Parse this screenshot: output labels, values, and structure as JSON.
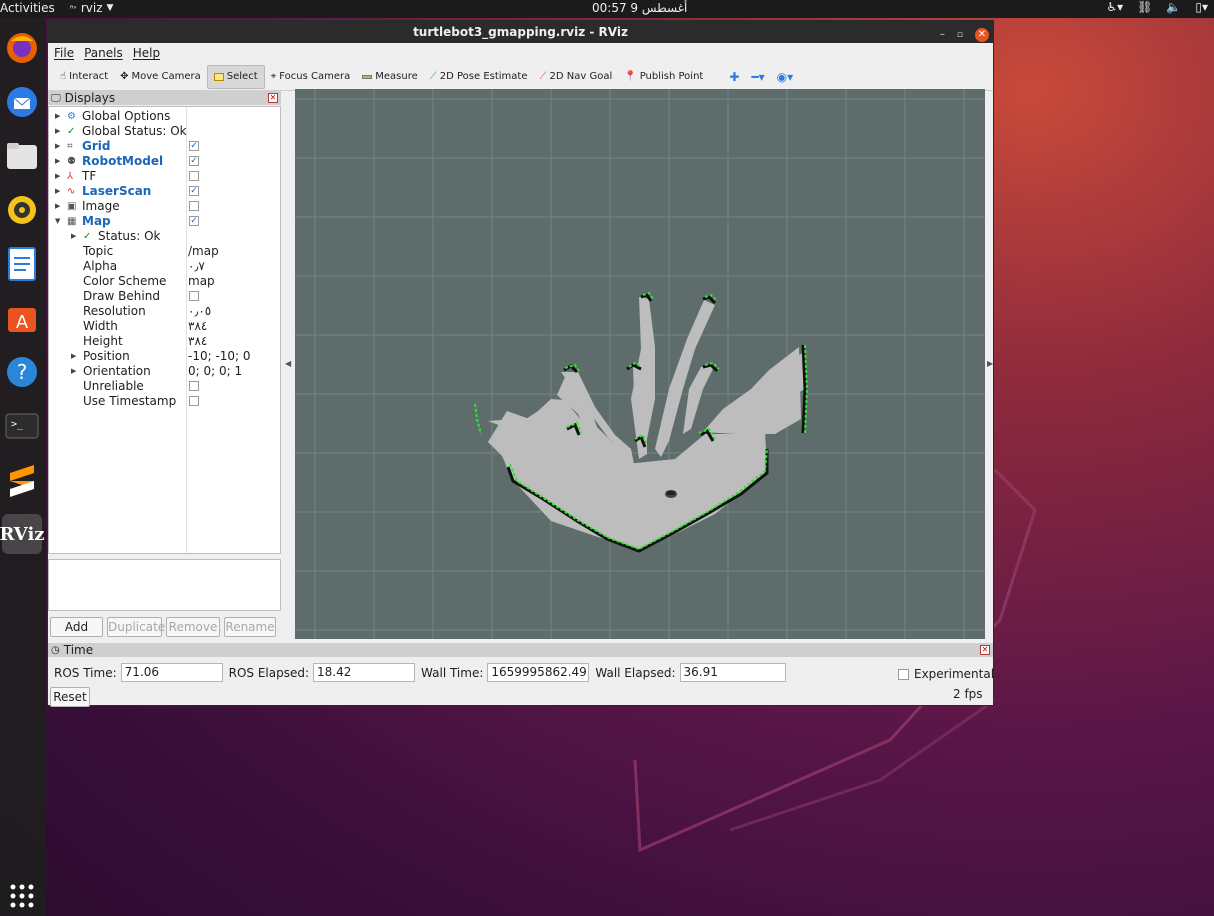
{
  "topbar": {
    "activities": "Activities",
    "app": "rviz",
    "clock": "00:57  9 أغسطس"
  },
  "window": {
    "title": "turtlebot3_gmapping.rviz - RViz"
  },
  "menu": {
    "file": "File",
    "panels": "Panels",
    "help": "Help"
  },
  "toolbar": {
    "interact": "Interact",
    "move_camera": "Move Camera",
    "select": "Select",
    "focus_camera": "Focus Camera",
    "measure": "Measure",
    "pose_estimate": "2D Pose Estimate",
    "nav_goal": "2D Nav Goal",
    "publish_point": "Publish Point"
  },
  "displays": {
    "title": "Displays",
    "rows": [
      {
        "label": "Global Options"
      },
      {
        "label": "Global Status: Ok"
      },
      {
        "label": "Grid",
        "checked": true
      },
      {
        "label": "RobotModel",
        "checked": true
      },
      {
        "label": "TF",
        "checked": false
      },
      {
        "label": "LaserScan",
        "checked": true
      },
      {
        "label": "Image",
        "checked": false
      },
      {
        "label": "Map",
        "checked": true
      },
      {
        "label": "Status: Ok"
      },
      {
        "label": "Topic",
        "value": "/map"
      },
      {
        "label": "Alpha",
        "value": "٠٫٧"
      },
      {
        "label": "Color Scheme",
        "value": "map"
      },
      {
        "label": "Draw Behind",
        "checked": false
      },
      {
        "label": "Resolution",
        "value": "٠٫٠٥"
      },
      {
        "label": "Width",
        "value": "٣٨٤"
      },
      {
        "label": "Height",
        "value": "٣٨٤"
      },
      {
        "label": "Position",
        "value": "-10; -10; 0"
      },
      {
        "label": "Orientation",
        "value": "0; 0; 0; 1"
      },
      {
        "label": "Unreliable",
        "checked": false
      },
      {
        "label": "Use Timestamp",
        "checked": false
      }
    ],
    "buttons": {
      "add": "Add",
      "duplicate": "Duplicate",
      "remove": "Remove",
      "rename": "Rename"
    }
  },
  "time": {
    "title": "Time",
    "ros_time_label": "ROS Time:",
    "ros_time": "71.06",
    "ros_elapsed_label": "ROS Elapsed:",
    "ros_elapsed": "18.42",
    "wall_time_label": "Wall Time:",
    "wall_time": "1659995862.49",
    "wall_elapsed_label": "Wall Elapsed:",
    "wall_elapsed": "36.91",
    "experimental": "Experimental",
    "reset": "Reset",
    "fps": "2 fps"
  },
  "colors": {
    "viewport_bg": "#5e6d6c",
    "map_free": "#bdbdbd",
    "map_wall": "#111111",
    "laser": "#2ee62e",
    "accent_blue": "#1a66b8"
  }
}
